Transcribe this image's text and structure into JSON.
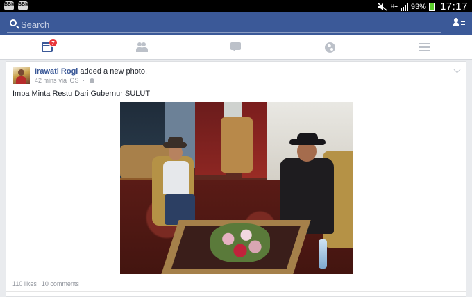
{
  "status_bar": {
    "time": "17:17",
    "battery": "93%",
    "network": "H+",
    "left_apps": [
      "BBM",
      "BBM"
    ]
  },
  "search": {
    "placeholder": "Search"
  },
  "tabs": {
    "notifications_count": "7",
    "items": [
      "news-feed",
      "friends",
      "messages",
      "notifications",
      "more"
    ]
  },
  "post": {
    "author": "Irawati Rogi",
    "action": " added a new photo.",
    "time": "42 mins",
    "via": "via iOS",
    "caption": "Imba Minta Restu Dari Gubernur SULUT",
    "likes": "110 likes",
    "comments": "10 comments"
  },
  "colors": {
    "facebook_blue": "#3b5998",
    "badge_red": "#e9353a",
    "battery_green": "#5ccf2d"
  }
}
